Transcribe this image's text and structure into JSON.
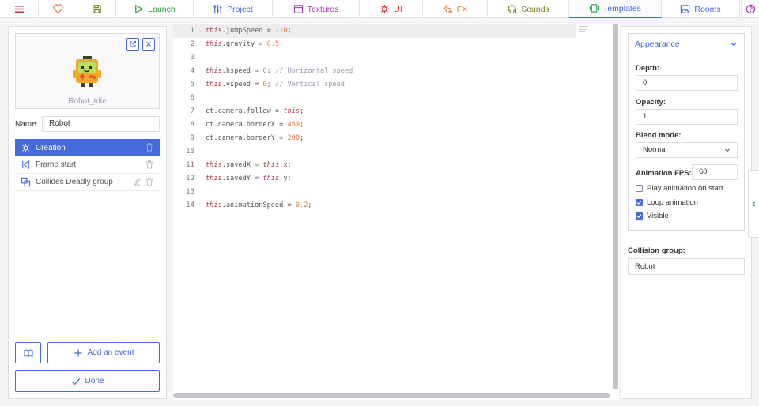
{
  "nav": {
    "tabs": [
      {
        "label": "Launch",
        "icon": "play-icon",
        "color": "#2a9d3a"
      },
      {
        "label": "Project",
        "icon": "sliders-icon",
        "color": "#446adb"
      },
      {
        "label": "Textures",
        "icon": "texture-icon",
        "color": "#a63ab5"
      },
      {
        "label": "UI",
        "icon": "ui-icon",
        "color": "#d22d2d"
      },
      {
        "label": "FX",
        "icon": "sparkles-icon",
        "color": "#e8743b"
      },
      {
        "label": "Sounds",
        "icon": "headphones-icon",
        "color": "#7a7c1e"
      },
      {
        "label": "Templates",
        "icon": "template-icon",
        "color": "#2a9d3a"
      },
      {
        "label": "Rooms",
        "icon": "image-icon",
        "color": "#446adb"
      }
    ],
    "active_tab": "Templates"
  },
  "template": {
    "preview_name": "Robot_Idle",
    "name_label": "Name:",
    "name_value": "Robot"
  },
  "events": [
    {
      "label": "Creation",
      "icon": "sun-icon",
      "selected": true
    },
    {
      "label": "Frame start",
      "icon": "skip-back-icon",
      "selected": false
    },
    {
      "label": "Collides Deadly group",
      "icon": "copy-icon",
      "selected": false
    }
  ],
  "buttons": {
    "add_event": "Add an event",
    "done": "Done"
  },
  "code": {
    "lines": [
      "this.jumpSpeed = -10;",
      "this.gravity = 0.5;",
      "",
      "this.hspeed = 0; // Horizontal speed",
      "this.vspeed = 0; // Vertical speed",
      "",
      "ct.camera.follow = this;",
      "ct.camera.borderX = 450;",
      "ct.camera.borderY = 200;",
      "",
      "this.savedX = this.x;",
      "this.savedY = this.y;",
      "",
      "this.animationSpeed = 0.2;"
    ],
    "line_numbers": [
      "1",
      "2",
      "3",
      "4",
      "5",
      "6",
      "7",
      "8",
      "9",
      "10",
      "11",
      "12",
      "13",
      "14"
    ]
  },
  "appearance": {
    "title": "Appearance",
    "depth_label": "Depth:",
    "depth_value": "0",
    "opacity_label": "Opacity:",
    "opacity_value": "1",
    "blend_label": "Blend mode:",
    "blend_value": "Normal",
    "fps_label": "Animation FPS:",
    "fps_value": "60",
    "checks": [
      {
        "label": "Play animation on start",
        "checked": false
      },
      {
        "label": "Loop animation",
        "checked": true
      },
      {
        "label": "Visible",
        "checked": true
      }
    ]
  },
  "collision": {
    "label": "Collision group:",
    "value": "Robot"
  },
  "colors": {
    "accent": "#446adb",
    "keyword": "#b23a48",
    "number": "#e8743b"
  }
}
